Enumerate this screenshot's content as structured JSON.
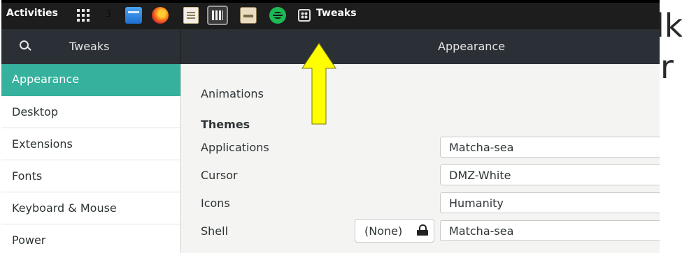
{
  "bg_text": {
    "line1": "lk",
    "line2": "r"
  },
  "topbar": {
    "activities": "Activities",
    "workspace_number": "3",
    "app_title": "Tweaks"
  },
  "header": {
    "sidebar_title": "Tweaks",
    "main_title": "Appearance"
  },
  "sidebar": {
    "items": [
      {
        "label": "Appearance",
        "selected": true
      },
      {
        "label": "Desktop",
        "selected": false
      },
      {
        "label": "Extensions",
        "selected": false
      },
      {
        "label": "Fonts",
        "selected": false
      },
      {
        "label": "Keyboard & Mouse",
        "selected": false
      },
      {
        "label": "Power",
        "selected": false
      }
    ]
  },
  "main": {
    "animations_label": "Animations",
    "themes_heading": "Themes",
    "rows": [
      {
        "label": "Applications",
        "value": "Matcha-sea"
      },
      {
        "label": "Cursor",
        "value": "DMZ-White"
      },
      {
        "label": "Icons",
        "value": "Humanity"
      },
      {
        "label": "Shell",
        "value": "Matcha-sea"
      }
    ],
    "shell_reset_label": "(None)"
  },
  "colors": {
    "accent": "#36b19d",
    "headerbar": "#2b3036",
    "topbar": "#1d1d1d",
    "arrow": "#ffff00"
  },
  "icons": {
    "search": "search-icon",
    "apps": "apps-grid-icon",
    "reset": "reset-icon"
  }
}
